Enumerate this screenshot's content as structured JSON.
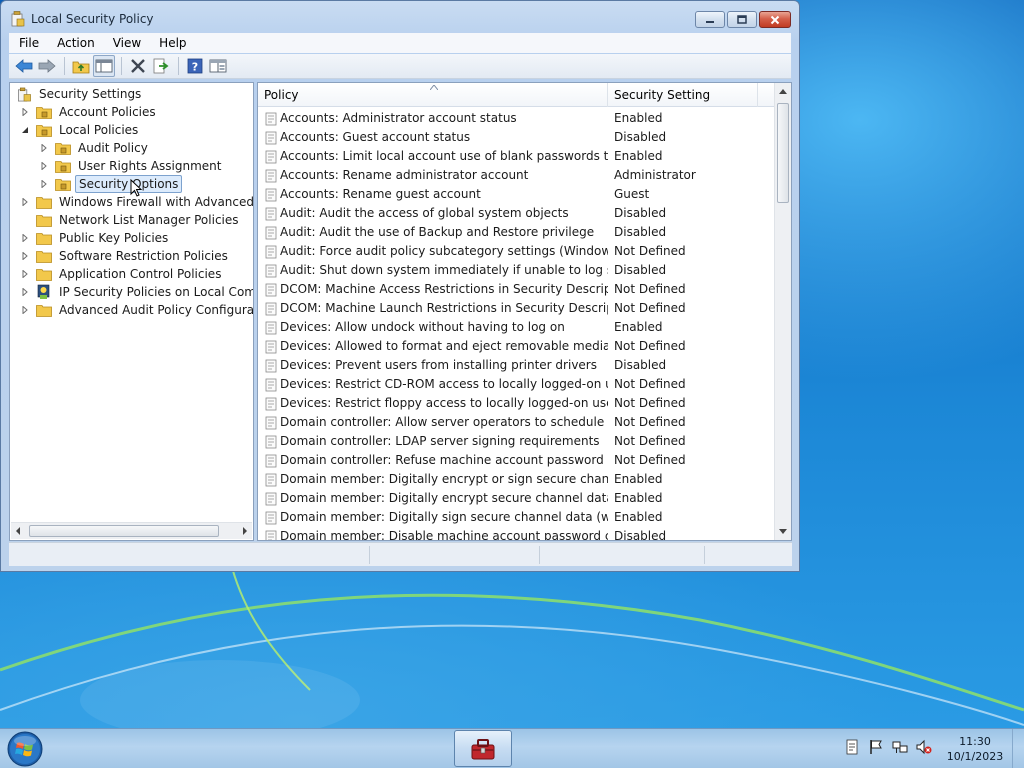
{
  "window": {
    "title": "Local Security Policy"
  },
  "menu": {
    "file": "File",
    "action": "Action",
    "view": "View",
    "help": "Help"
  },
  "tree": {
    "root": "Security Settings",
    "account_policies": "Account Policies",
    "local_policies": "Local Policies",
    "audit_policy": "Audit Policy",
    "user_rights_assignment": "User Rights Assignment",
    "security_options": "Security Options",
    "windows_firewall": "Windows Firewall with Advanced Security",
    "network_list": "Network List Manager Policies",
    "public_key": "Public Key Policies",
    "software_restriction": "Software Restriction Policies",
    "application_control": "Application Control Policies",
    "ip_security": "IP Security Policies on Local Computer",
    "advanced_audit": "Advanced Audit Policy Configuration"
  },
  "list": {
    "col_policy": "Policy",
    "col_setting": "Security Setting",
    "rows": [
      {
        "policy": "Accounts: Administrator account status",
        "setting": "Enabled"
      },
      {
        "policy": "Accounts: Guest account status",
        "setting": "Disabled"
      },
      {
        "policy": "Accounts: Limit local account use of blank passwords to co...",
        "setting": "Enabled"
      },
      {
        "policy": "Accounts: Rename administrator account",
        "setting": "Administrator"
      },
      {
        "policy": "Accounts: Rename guest account",
        "setting": "Guest"
      },
      {
        "policy": "Audit: Audit the access of global system objects",
        "setting": "Disabled"
      },
      {
        "policy": "Audit: Audit the use of Backup and Restore privilege",
        "setting": "Disabled"
      },
      {
        "policy": "Audit: Force audit policy subcategory settings (Windows Vis...",
        "setting": "Not Defined"
      },
      {
        "policy": "Audit: Shut down system immediately if unable to log secur...",
        "setting": "Disabled"
      },
      {
        "policy": "DCOM: Machine Access Restrictions in Security Descriptor D...",
        "setting": "Not Defined"
      },
      {
        "policy": "DCOM: Machine Launch Restrictions in Security Descriptor ...",
        "setting": "Not Defined"
      },
      {
        "policy": "Devices: Allow undock without having to log on",
        "setting": "Enabled"
      },
      {
        "policy": "Devices: Allowed to format and eject removable media",
        "setting": "Not Defined"
      },
      {
        "policy": "Devices: Prevent users from installing printer drivers",
        "setting": "Disabled"
      },
      {
        "policy": "Devices: Restrict CD-ROM access to locally logged-on user ...",
        "setting": "Not Defined"
      },
      {
        "policy": "Devices: Restrict floppy access to locally logged-on user only",
        "setting": "Not Defined"
      },
      {
        "policy": "Domain controller: Allow server operators to schedule tasks",
        "setting": "Not Defined"
      },
      {
        "policy": "Domain controller: LDAP server signing requirements",
        "setting": "Not Defined"
      },
      {
        "policy": "Domain controller: Refuse machine account password chan...",
        "setting": "Not Defined"
      },
      {
        "policy": "Domain member: Digitally encrypt or sign secure channel d...",
        "setting": "Enabled"
      },
      {
        "policy": "Domain member: Digitally encrypt secure channel data (wh...",
        "setting": "Enabled"
      },
      {
        "policy": "Domain member: Digitally sign secure channel data (when ...",
        "setting": "Enabled"
      },
      {
        "policy": "Domain member: Disable machine account password chan...",
        "setting": "Disabled"
      }
    ]
  },
  "taskbar": {
    "time": "11:30",
    "date": "10/1/2023"
  },
  "colors": {
    "selection": "#dcebfc",
    "folder": "#f2c84b",
    "window_frame": "#b8d0ee"
  },
  "icons": {
    "back": "back-arrow-icon",
    "forward": "forward-arrow-icon",
    "up": "up-folder-icon",
    "show_hide_tree": "show-hide-console-tree-icon",
    "delete": "delete-icon",
    "export": "export-list-icon",
    "help": "help-icon",
    "properties": "properties-icon"
  }
}
